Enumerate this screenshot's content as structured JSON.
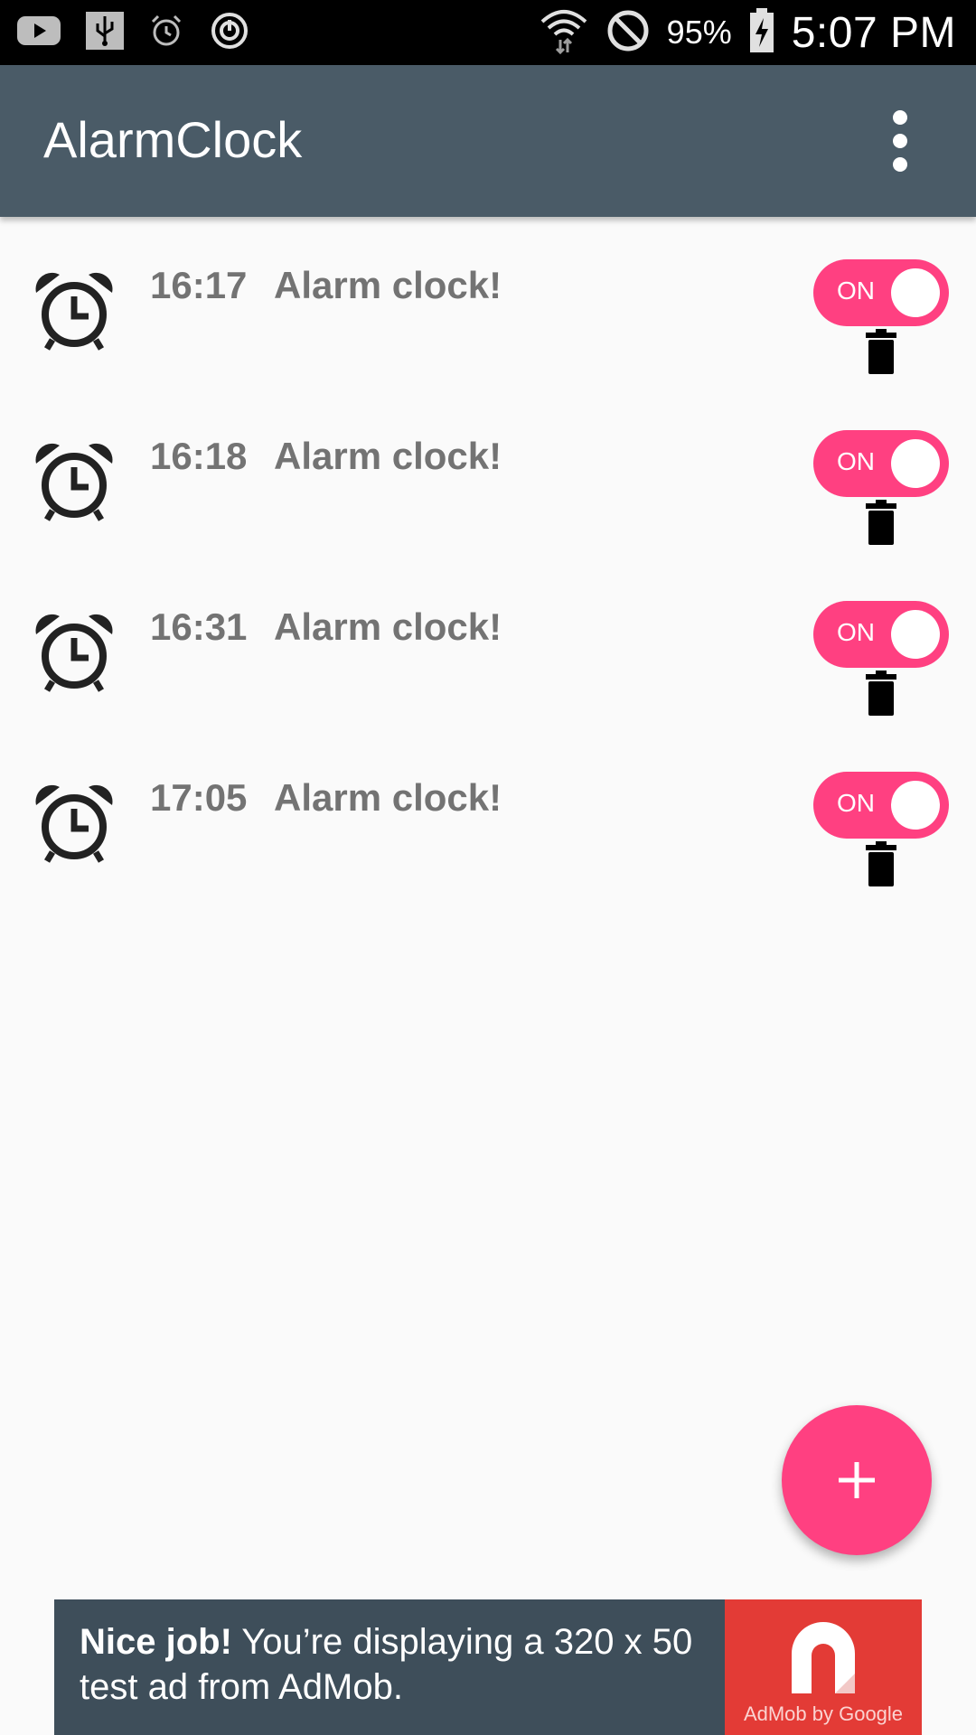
{
  "status_bar": {
    "battery_percent": "95%",
    "time": "5:07 PM",
    "icons_left": [
      "youtube-icon",
      "usb-icon",
      "alarm-icon",
      "sync-icon"
    ],
    "icons_right": [
      "wifi-icon",
      "do-not-disturb-icon",
      "battery-charging-icon"
    ]
  },
  "app_bar": {
    "title": "AlarmClock",
    "menu_icon": "more-vert-icon"
  },
  "alarms": [
    {
      "time": "16:17",
      "label": "Alarm clock!",
      "switch_label": "ON",
      "enabled": true
    },
    {
      "time": "16:18",
      "label": "Alarm clock!",
      "switch_label": "ON",
      "enabled": true
    },
    {
      "time": "16:31",
      "label": "Alarm clock!",
      "switch_label": "ON",
      "enabled": true
    },
    {
      "time": "17:05",
      "label": "Alarm clock!",
      "switch_label": "ON",
      "enabled": true
    }
  ],
  "fab": {
    "icon": "plus-icon"
  },
  "ad": {
    "headline": "Nice job!",
    "body": "You’re displaying a 320 x 50 test ad from AdMob.",
    "brand": "AdMob by Google"
  },
  "colors": {
    "accent": "#ff4081",
    "app_bar": "#4a5b67",
    "ad_background": "#3e4e5a",
    "ad_logo": "#e33b36"
  }
}
